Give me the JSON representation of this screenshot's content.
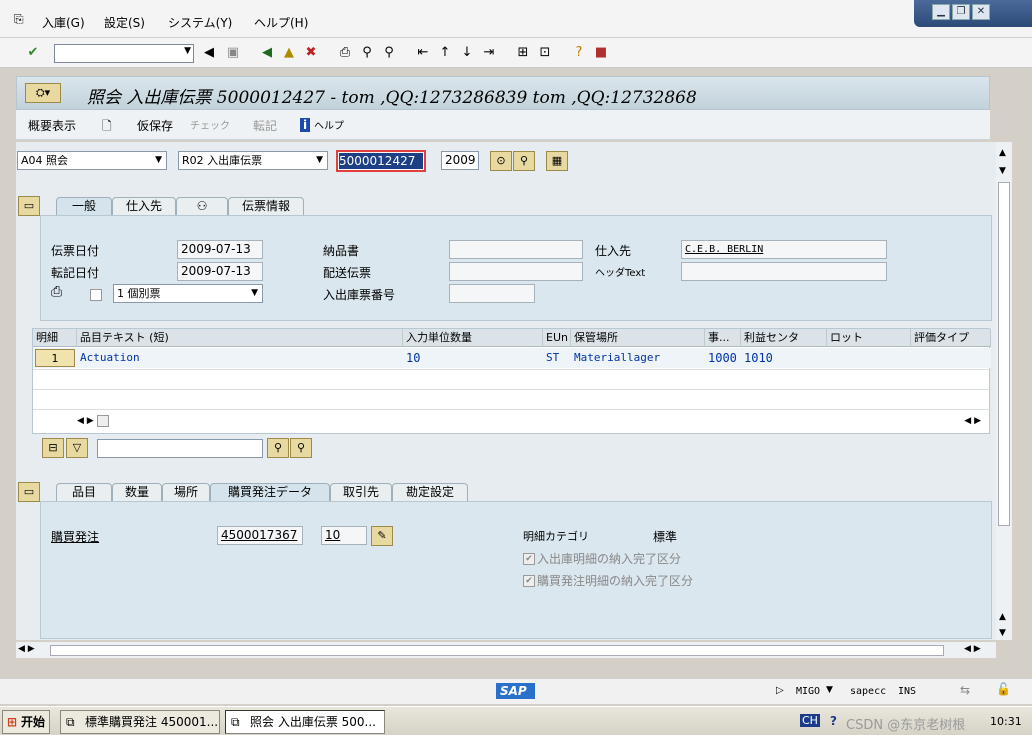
{
  "menu": {
    "items": [
      "入庫(G)",
      "設定(S)",
      "システム(Y)",
      "ヘルプ(H)"
    ]
  },
  "title": {
    "text": "照会 入出庫伝票 5000012427 - tom ,QQ:1273286839 tom ,QQ:12732868"
  },
  "app_toolbar": {
    "overview": "概要表示",
    "hold": "仮保存",
    "check": "チェック",
    "post": "転記",
    "help": "ヘルプ"
  },
  "header": {
    "action": "A04 照会",
    "doc_type": "R02 入出庫伝票",
    "doc_number": "5000012427",
    "year": "2009"
  },
  "tabs_top": [
    "一般",
    "仕入先",
    "",
    "伝票情報"
  ],
  "general": {
    "doc_date_label": "伝票日付",
    "doc_date": "2009-07-13",
    "post_date_label": "転記日付",
    "post_date": "2009-07-13",
    "print_option": "1 個別票",
    "delivery_note_label": "納品書",
    "bill_lading_label": "配送伝票",
    "gr_slip_label": "入出庫票番号",
    "vendor_label": "仕入先",
    "vendor_value": "C.E.B. BERLIN",
    "header_text_label": "ヘッダText"
  },
  "grid": {
    "headers": [
      "明細",
      "品目テキスト (短)",
      "入力単位数量",
      "EUn",
      "保管場所",
      "事...",
      "利益センタ",
      "ロット",
      "評価タイプ"
    ],
    "rows": [
      {
        "item": "1",
        "text": "Actuation",
        "qty": "10",
        "unit": "ST",
        "sloc": "Materiallager",
        "bus": "1000",
        "pc": "1010"
      }
    ]
  },
  "tabs_bottom": [
    "品目",
    "数量",
    "場所",
    "購買発注データ",
    "取引先",
    "勘定設定"
  ],
  "po": {
    "label": "購買発注",
    "number": "4500017367",
    "item": "10",
    "item_cat_label": "明細カテゴリ",
    "item_cat_value": "標準",
    "delivery_completed": "入出庫明細の納入完了区分",
    "po_delivery_completed": "購買発注明細の納入完了区分"
  },
  "status": {
    "tcode": "MIGO",
    "server": "sapecc",
    "mode": "INS"
  },
  "taskbar": {
    "start": "开始",
    "win1": "標準購買発注 450001...",
    "win2": "照会 入出庫伝票 500...",
    "lang": "CH",
    "time": "10:31",
    "watermark": "CSDN @东京老树根"
  },
  "colors": {
    "title_bg": "#c2d2da",
    "accent": "#0033aa"
  }
}
